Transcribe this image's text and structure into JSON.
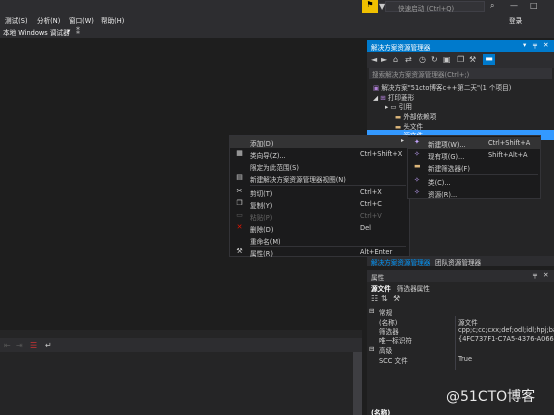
{
  "titlebar": {
    "quick_launch_placeholder": "快速启动 (Ctrl+Q)",
    "login": "登录",
    "flag_icon": "flag-icon"
  },
  "menu": [
    "测试(S)",
    "分析(N)",
    "窗口(W)",
    "帮助(H)"
  ],
  "toolbar": {
    "debugger_label": "本地 Windows 调试器",
    "debugger_arrow": "▾"
  },
  "solution_explorer": {
    "title": "解决方案资源管理器",
    "search_placeholder": "搜索解决方案资源管理器(Ctrl+;)",
    "tree": [
      {
        "label": "解决方案\"51cto博客c++第二天\"(1 个项目)",
        "indent": 0,
        "selected": false
      },
      {
        "label": "打印菱形",
        "indent": 1,
        "selected": false
      },
      {
        "label": "引用",
        "indent": 2,
        "selected": false
      },
      {
        "label": "外部依赖项",
        "indent": 2,
        "selected": false
      },
      {
        "label": "头文件",
        "indent": 2,
        "selected": false
      },
      {
        "label": "源文件",
        "indent": 2,
        "selected": true
      }
    ],
    "tabs": [
      "解决方案资源管理器",
      "团队资源管理器"
    ]
  },
  "properties": {
    "title": "属性",
    "subject": "源文件",
    "subject_type": "筛选器属性",
    "section_general": "常规",
    "section_advanced": "高级",
    "rows": [
      {
        "key": "(名称)",
        "value": "源文件"
      },
      {
        "key": "筛选器",
        "value": "cpp;c;cc;cxx;def;odl;idl;hpj;bat"
      },
      {
        "key": "唯一标识符",
        "value": "{4FC737F1-C7A5-4376-A066-2"
      }
    ],
    "adv_rows": [
      {
        "key": "SCC 文件",
        "value": "True"
      }
    ],
    "footer": "(名称)"
  },
  "context_menu": {
    "items": [
      {
        "label": "添加(D)",
        "shortcut": "",
        "icon": "",
        "submenu": true,
        "disabled": false,
        "highlighted": true
      },
      {
        "label": "类向导(Z)...",
        "shortcut": "Ctrl+Shift+X",
        "icon": "class-wizard-icon",
        "submenu": false,
        "disabled": false,
        "highlighted": false
      },
      {
        "label": "限定为此范围(S)",
        "shortcut": "",
        "icon": "",
        "submenu": false,
        "disabled": false,
        "highlighted": false
      },
      {
        "label": "新建解决方案资源管理器视图(N)",
        "shortcut": "",
        "icon": "new-view-icon",
        "submenu": false,
        "disabled": false,
        "highlighted": false
      },
      {
        "label": "剪切(T)",
        "shortcut": "Ctrl+X",
        "icon": "cut-icon",
        "submenu": false,
        "disabled": false,
        "highlighted": false
      },
      {
        "label": "复制(Y)",
        "shortcut": "Ctrl+C",
        "icon": "copy-icon",
        "submenu": false,
        "disabled": false,
        "highlighted": false
      },
      {
        "label": "粘贴(P)",
        "shortcut": "Ctrl+V",
        "icon": "paste-icon",
        "submenu": false,
        "disabled": true,
        "highlighted": false
      },
      {
        "label": "删除(D)",
        "shortcut": "Del",
        "icon": "delete-icon",
        "submenu": false,
        "disabled": false,
        "highlighted": false
      },
      {
        "label": "重命名(M)",
        "shortcut": "",
        "icon": "",
        "submenu": false,
        "disabled": false,
        "highlighted": false
      },
      {
        "label": "属性(R)",
        "shortcut": "Alt+Enter",
        "icon": "wrench-icon",
        "submenu": false,
        "disabled": false,
        "highlighted": false
      }
    ]
  },
  "submenu": {
    "items": [
      {
        "label": "新建项(W)...",
        "shortcut": "Ctrl+Shift+A",
        "icon": "new-item-icon"
      },
      {
        "label": "现有项(G)...",
        "shortcut": "Shift+Alt+A",
        "icon": "existing-item-icon"
      },
      {
        "label": "新建筛选器(F)",
        "shortcut": "",
        "icon": "new-filter-icon"
      },
      {
        "label": "类(C)...",
        "shortcut": "",
        "icon": "class-icon"
      },
      {
        "label": "资源(R)...",
        "shortcut": "",
        "icon": "resource-icon"
      }
    ]
  },
  "watermark": "@51CTO博客",
  "colors": {
    "accent": "#007acc",
    "selection": "#3399ff",
    "background": "#1e1e1e",
    "panel": "#252526"
  }
}
